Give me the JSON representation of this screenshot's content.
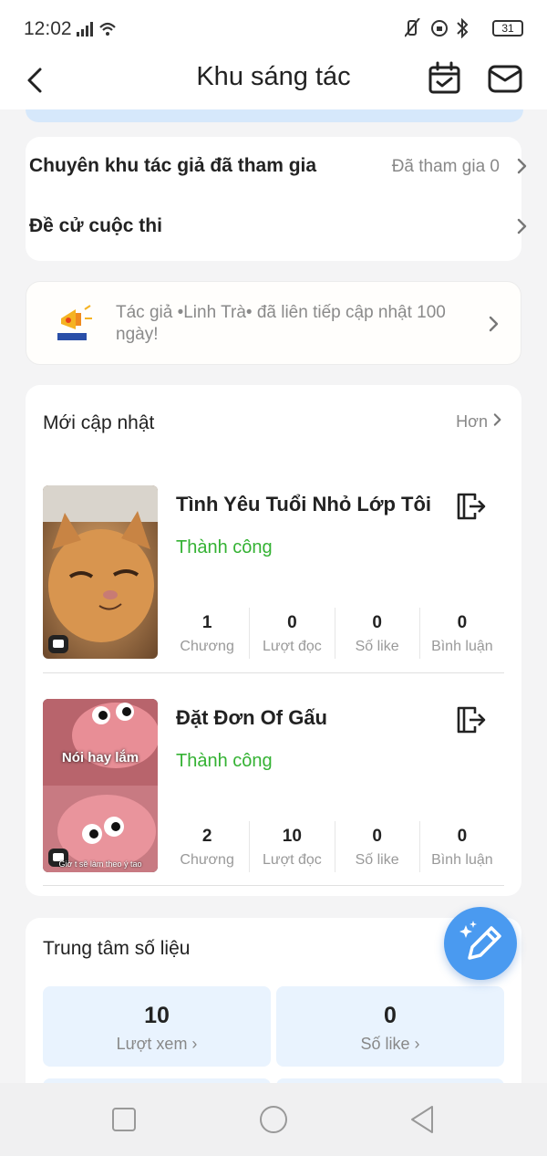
{
  "status_bar": {
    "time": "12:02",
    "battery": "31"
  },
  "header": {
    "title": "Khu sáng tác"
  },
  "menu": {
    "joined_author_zone": {
      "label": "Chuyên khu tác giả đã tham gia",
      "value": "Đã tham gia 0"
    },
    "contest": {
      "label": "Đề cử cuộc thi"
    }
  },
  "announcement": {
    "text": "Tác giả •Linh Trà• đã liên tiếp cập nhật 100 ngày!"
  },
  "updates": {
    "title": "Mới cập nhật",
    "more": "Hơn",
    "stories": [
      {
        "title": "Tình Yêu Tuổi Nhỏ Lớp Tôi",
        "status": "Thành công",
        "stats": [
          {
            "value": "1",
            "label": "Chương"
          },
          {
            "value": "0",
            "label": "Lượt đọc"
          },
          {
            "value": "0",
            "label": "Số like"
          },
          {
            "value": "0",
            "label": "Bình luận"
          }
        ]
      },
      {
        "title": "Đặt Đơn Of Gấu",
        "status": "Thành công",
        "cover_caption_top": "Nói hay lắm",
        "cover_caption_bottom": "Giờ t sẽ làm theo ý tao",
        "stats": [
          {
            "value": "2",
            "label": "Chương"
          },
          {
            "value": "10",
            "label": "Lượt đọc"
          },
          {
            "value": "0",
            "label": "Số like"
          },
          {
            "value": "0",
            "label": "Bình luận"
          }
        ]
      }
    ]
  },
  "data_center": {
    "title": "Trung tâm số liệu",
    "metrics": [
      {
        "value": "10",
        "label": "Lượt xem ›"
      },
      {
        "value": "0",
        "label": "Số like ›"
      }
    ]
  },
  "colors": {
    "accent_blue": "#4a9af0",
    "success_green": "#34b233",
    "metric_bg": "#e9f3fe"
  }
}
